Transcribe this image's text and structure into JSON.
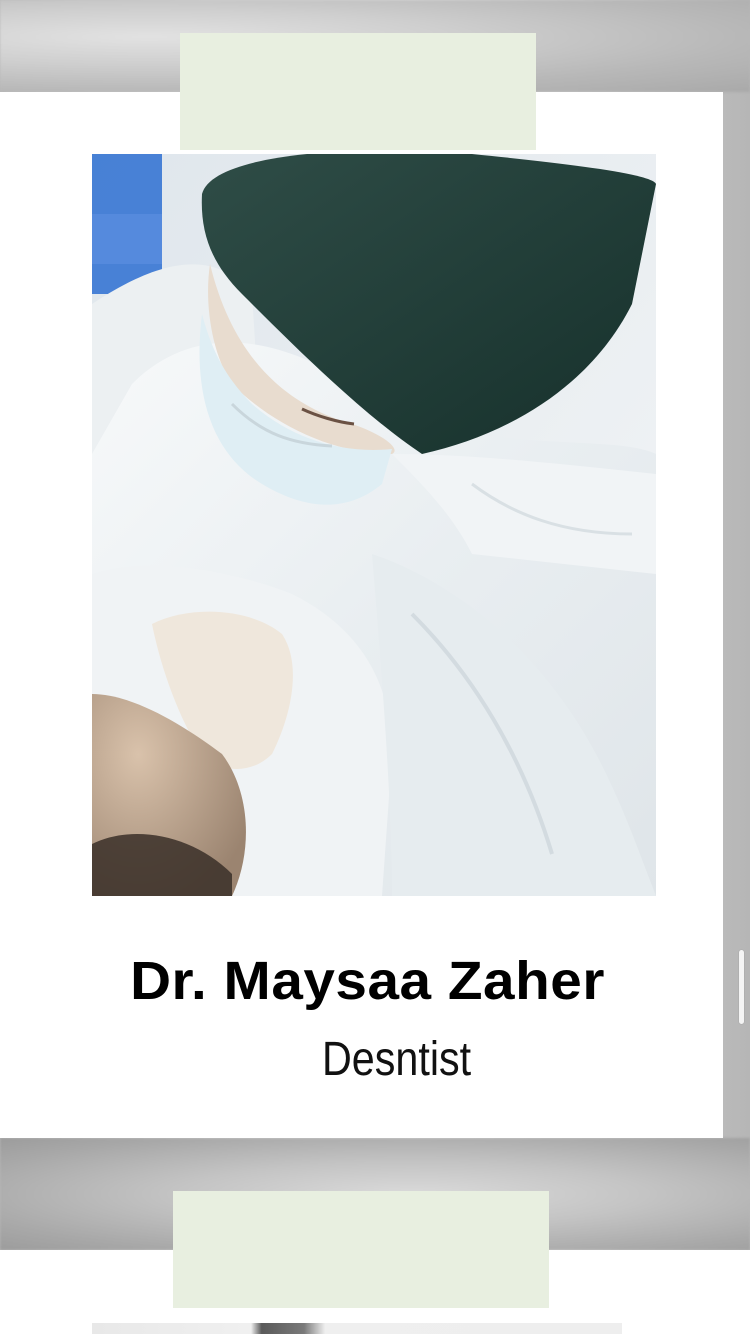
{
  "profile": {
    "name": "Dr. Maysaa Zaher",
    "role": "Desntist"
  },
  "colors": {
    "label_strip": "#e8efe0",
    "card": "#ffffff",
    "scrub_cap": "#23403a",
    "gown": "#f2f5f6"
  },
  "icons": {
    "scroll": "scroll-indicator"
  }
}
